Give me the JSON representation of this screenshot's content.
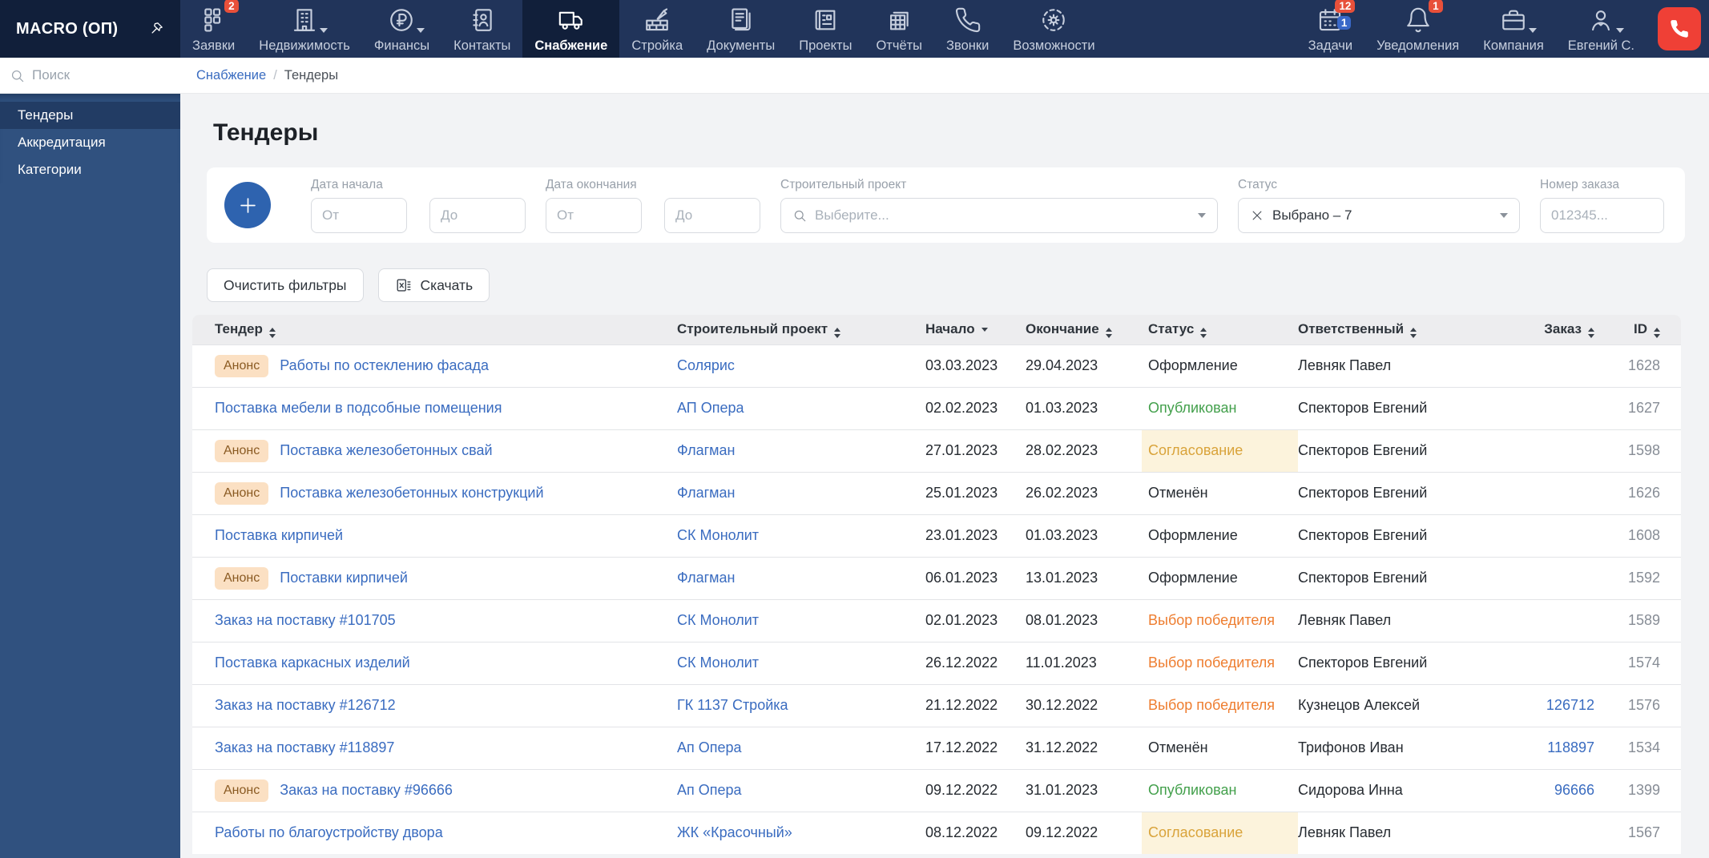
{
  "colors": {
    "nav_bg": "#21345a",
    "nav_dark": "#111f3a",
    "sidebar_bg": "#30517f",
    "sidebar_active": "#223c64",
    "page_bg": "#f2f3f5",
    "link": "#3a6cc0",
    "accent_blue": "#2e63af",
    "call_red": "#ef4036",
    "badge_red": "#e8503a",
    "badge_blue": "#3968c8",
    "announce_bg": "#fbe0c3",
    "announce_text": "#8a5a22",
    "status_published": "#43a04c",
    "status_approval": "#d9a33a",
    "status_approval_bg": "#fcf3dc",
    "status_winner": "#ee7d2f",
    "table_header_bg": "#ededef",
    "id_text": "#878d96"
  },
  "nav": {
    "logo": "MACRO (ОП)",
    "items": [
      {
        "name": "requests",
        "label": "Заявки",
        "icon": "grid-icon",
        "badge": "2"
      },
      {
        "name": "realty",
        "label": "Недвижимость",
        "icon": "building-icon",
        "caret": true
      },
      {
        "name": "finance",
        "label": "Финансы",
        "icon": "ruble-icon",
        "caret": true
      },
      {
        "name": "contacts",
        "label": "Контакты",
        "icon": "contacts-icon"
      },
      {
        "name": "supplies",
        "label": "Снабжение",
        "icon": "truck-icon",
        "active": true
      },
      {
        "name": "construction",
        "label": "Стройка",
        "icon": "construction-icon"
      },
      {
        "name": "documents",
        "label": "Документы",
        "icon": "documents-icon"
      },
      {
        "name": "projects",
        "label": "Проекты",
        "icon": "blueprint-icon"
      },
      {
        "name": "reports",
        "label": "Отчёты",
        "icon": "reports-icon"
      },
      {
        "name": "calls",
        "label": "Звонки",
        "icon": "phone-icon"
      },
      {
        "name": "features",
        "label": "Возможности",
        "icon": "gear-icon"
      }
    ],
    "right_items": [
      {
        "name": "tasks",
        "label": "Задачи",
        "icon": "calendar-icon",
        "badge_red": "12",
        "badge_blue": "1"
      },
      {
        "name": "notifications",
        "label": "Уведомления",
        "icon": "bell-icon",
        "badge_red": "1"
      },
      {
        "name": "company",
        "label": "Компания",
        "icon": "briefcase-icon",
        "caret": true
      },
      {
        "name": "user-menu",
        "label": "Евгений С.",
        "icon": "user-icon",
        "caret": true
      }
    ]
  },
  "sidebar": {
    "search_placeholder": "Поиск",
    "items": [
      {
        "name": "tenders",
        "label": "Тендеры",
        "active": true
      },
      {
        "name": "accreditation",
        "label": "Аккредитация"
      },
      {
        "name": "categories",
        "label": "Категории"
      }
    ]
  },
  "breadcrumb": {
    "parent": "Снабжение",
    "separator": "/",
    "current": "Тендеры"
  },
  "page": {
    "title": "Тендеры"
  },
  "filters": {
    "date_start": {
      "label": "Дата начала",
      "from_placeholder": "От",
      "to_placeholder": "До"
    },
    "date_end": {
      "label": "Дата окончания",
      "from_placeholder": "От",
      "to_placeholder": "До"
    },
    "project": {
      "label": "Строительный проект",
      "placeholder": "Выберите..."
    },
    "status": {
      "label": "Статус",
      "value": "Выбрано – 7"
    },
    "order_number": {
      "label": "Номер заказа",
      "placeholder": "012345..."
    }
  },
  "actions": {
    "clear_label": "Очистить фильтры",
    "download_label": "Скачать"
  },
  "table": {
    "announce_label": "Анонс",
    "columns": [
      {
        "label": "Тендер",
        "sort": "both",
        "key": "tender"
      },
      {
        "label": "Строительный проект",
        "sort": "both",
        "key": "project"
      },
      {
        "label": "Начало",
        "sort": "desc",
        "key": "start"
      },
      {
        "label": "Окончание",
        "sort": "both",
        "key": "end"
      },
      {
        "label": "Статус",
        "sort": "both",
        "key": "status"
      },
      {
        "label": "Ответственный",
        "sort": "both",
        "key": "responsible"
      },
      {
        "label": "Заказ",
        "sort": "both",
        "key": "order"
      },
      {
        "label": "ID",
        "sort": "both",
        "key": "id"
      }
    ],
    "rows": [
      {
        "announce": true,
        "tender": "Работы по остеклению фасада",
        "project": "Солярис",
        "start": "03.03.2023",
        "end": "29.04.2023",
        "status": "Оформление",
        "status_type": "default",
        "responsible": "Левняк Павел",
        "order": "",
        "id": "1628"
      },
      {
        "announce": false,
        "tender": "Поставка мебели в подсобные помещения",
        "project": "АП Опера",
        "start": "02.02.2023",
        "end": "01.03.2023",
        "status": "Опубликован",
        "status_type": "published",
        "responsible": "Спекторов Евгений",
        "order": "",
        "id": "1627"
      },
      {
        "announce": true,
        "tender": "Поставка железобетонных свай",
        "project": "Флагман",
        "start": "27.01.2023",
        "end": "28.02.2023",
        "status": "Согласование",
        "status_type": "approval",
        "responsible": "Спекторов Евгений",
        "order": "",
        "id": "1598"
      },
      {
        "announce": true,
        "tender": "Поставка железобетонных конструкций",
        "project": "Флагман",
        "start": "25.01.2023",
        "end": "26.02.2023",
        "status": "Отменён",
        "status_type": "default",
        "responsible": "Спекторов Евгений",
        "order": "",
        "id": "1626"
      },
      {
        "announce": false,
        "tender": "Поставка кирпичей",
        "project": "СК Монолит",
        "start": "23.01.2023",
        "end": "01.03.2023",
        "status": "Оформление",
        "status_type": "default",
        "responsible": "Спекторов Евгений",
        "order": "",
        "id": "1608"
      },
      {
        "announce": true,
        "tender": "Поставки кирпичей",
        "project": "Флагман",
        "start": "06.01.2023",
        "end": "13.01.2023",
        "status": "Оформление",
        "status_type": "default",
        "responsible": "Спекторов Евгений",
        "order": "",
        "id": "1592"
      },
      {
        "announce": false,
        "tender": "Заказ на поставку #101705",
        "project": "СК Монолит",
        "start": "02.01.2023",
        "end": "08.01.2023",
        "status": "Выбор победителя",
        "status_type": "winner",
        "responsible": "Левняк Павел",
        "order": "",
        "id": "1589"
      },
      {
        "announce": false,
        "tender": "Поставка каркасных изделий",
        "project": "СК Монолит",
        "start": "26.12.2022",
        "end": "11.01.2023",
        "status": "Выбор победителя",
        "status_type": "winner",
        "responsible": "Спекторов Евгений",
        "order": "",
        "id": "1574"
      },
      {
        "announce": false,
        "tender": "Заказ на поставку #126712",
        "project": "ГК 1137 Стройка",
        "start": "21.12.2022",
        "end": "30.12.2022",
        "status": "Выбор победителя",
        "status_type": "winner",
        "responsible": "Кузнецов Алексей",
        "order": "126712",
        "id": "1576"
      },
      {
        "announce": false,
        "tender": "Заказ на поставку #118897",
        "project": "Ап Опера",
        "start": "17.12.2022",
        "end": "31.12.2022",
        "status": "Отменён",
        "status_type": "default",
        "responsible": "Трифонов Иван",
        "order": "118897",
        "id": "1534"
      },
      {
        "announce": true,
        "tender": "Заказ на поставку #96666",
        "project": "Ап Опера",
        "start": "09.12.2022",
        "end": "31.01.2023",
        "status": "Опубликован",
        "status_type": "published",
        "responsible": "Сидорова Инна",
        "order": "96666",
        "id": "1399"
      },
      {
        "announce": false,
        "tender": "Работы по благоустройству двора",
        "project": "ЖК «Красочный»",
        "start": "08.12.2022",
        "end": "09.12.2022",
        "status": "Согласование",
        "status_type": "approval",
        "responsible": "Левняк Павел",
        "order": "",
        "id": "1567"
      }
    ]
  }
}
